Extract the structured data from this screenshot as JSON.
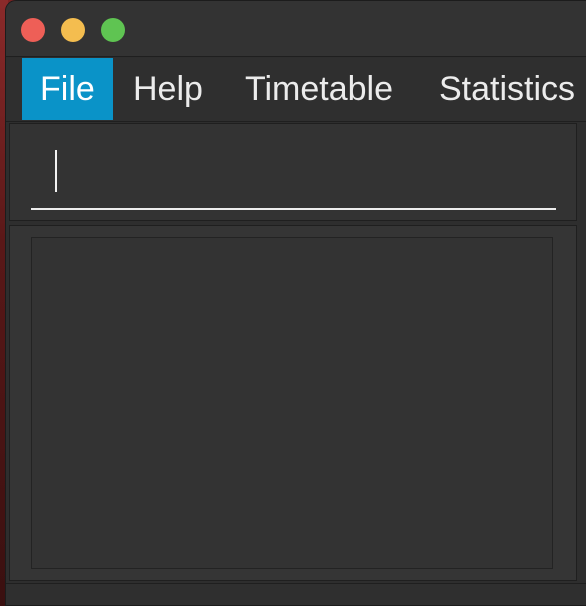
{
  "window": {
    "controls": {
      "close": "close-button",
      "minimize": "minimize-button",
      "zoom": "zoom-button"
    },
    "colors": {
      "close": "#ee5f57",
      "minimize": "#f4bd4f",
      "zoom": "#5fc452"
    }
  },
  "menu": {
    "items": [
      {
        "label": "File",
        "active": true
      },
      {
        "label": "Help",
        "active": false
      },
      {
        "label": "Timetable",
        "active": false
      },
      {
        "label": "Statistics",
        "active": false
      }
    ],
    "active_color": "#0a93c8"
  },
  "command": {
    "value": "",
    "placeholder": ""
  },
  "results": {
    "items": []
  },
  "status": {
    "text": ""
  }
}
